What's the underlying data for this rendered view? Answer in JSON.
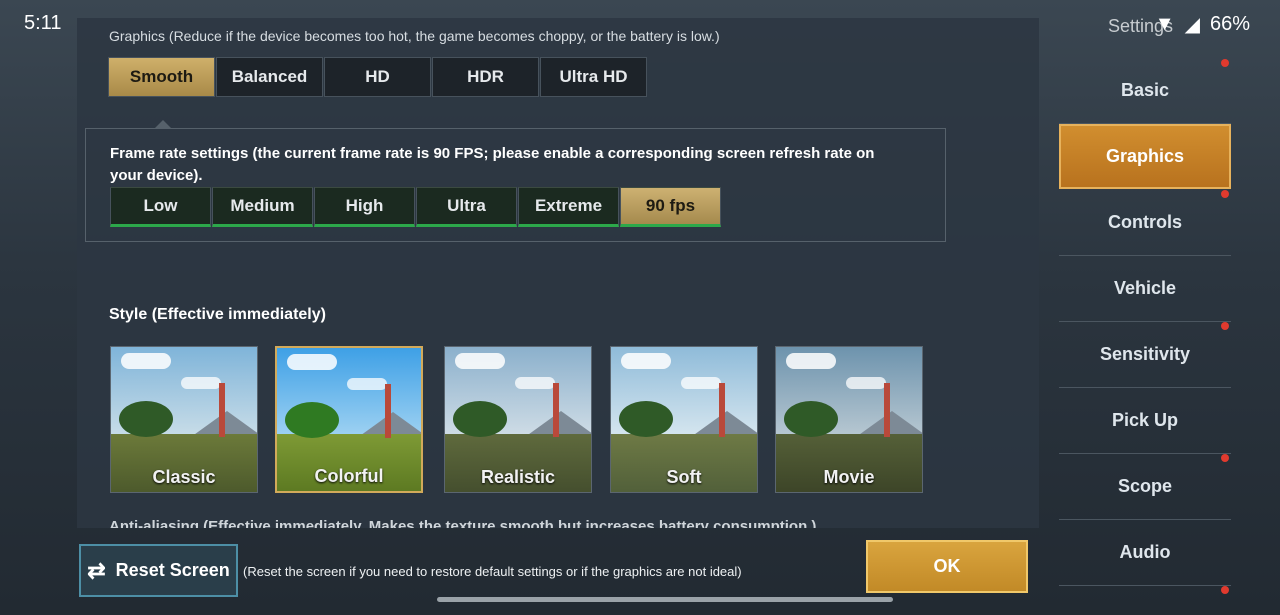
{
  "status_bar": {
    "time": "5:11",
    "battery": "66%"
  },
  "settings_title": "Settings",
  "graphics_label": "Graphics (Reduce if the device becomes too hot, the game becomes choppy, or the battery is low.)",
  "quality_options": [
    "Smooth",
    "Balanced",
    "HD",
    "HDR",
    "Ultra HD"
  ],
  "quality_selected": "Smooth",
  "frame_rate": {
    "text": "Frame rate settings (the current frame rate is 90 FPS; please enable a corresponding screen refresh rate on your device).",
    "options": [
      "Low",
      "Medium",
      "High",
      "Ultra",
      "Extreme",
      "90 fps"
    ],
    "selected": "90 fps"
  },
  "style": {
    "label": "Style (Effective immediately)",
    "options": [
      "Classic",
      "Colorful",
      "Realistic",
      "Soft",
      "Movie"
    ],
    "selected": "Colorful"
  },
  "anti_aliasing_label": "Anti-aliasing (Effective immediately. Makes the texture smooth but increases battery consumption.)",
  "sidebar": {
    "items": [
      "Basic",
      "Graphics",
      "Controls",
      "Vehicle",
      "Sensitivity",
      "Pick Up",
      "Scope",
      "Audio"
    ],
    "selected": "Graphics"
  },
  "reset": {
    "label": "Reset Screen",
    "note": "(Reset the screen if you need to restore default settings or if the graphics are not ideal)"
  },
  "ok_label": "OK"
}
